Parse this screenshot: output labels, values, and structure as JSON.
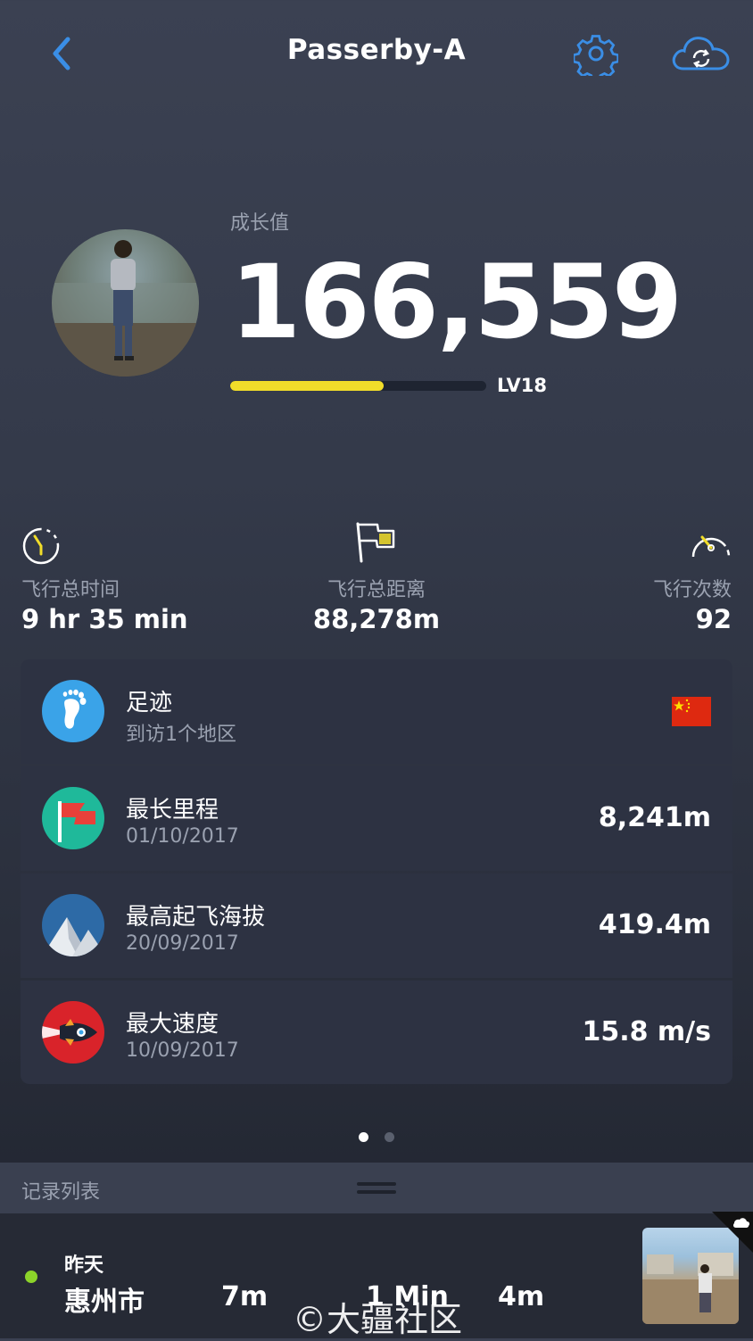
{
  "header": {
    "title": "Passerby-A",
    "back_icon": "chevron-left-icon",
    "settings_icon": "gear-icon",
    "sync_icon": "cloud-sync-icon",
    "accent": "#3a8ee6"
  },
  "profile": {
    "growth_label": "成长值",
    "growth_value": "166,559",
    "level": "LV18",
    "level_progress": 0.6,
    "bar_color": "#f1dd2a"
  },
  "stats": [
    {
      "label": "飞行总时间",
      "value": "9 hr 35 min",
      "icon": "stopwatch-icon"
    },
    {
      "label": "飞行总距离",
      "value": "88,278m",
      "icon": "flag-icon"
    },
    {
      "label": "飞行次数",
      "value": "92",
      "icon": "speedometer-icon"
    }
  ],
  "records": [
    {
      "title": "足迹",
      "subtitle": "到访1个地区",
      "value": "",
      "icon": "footprint-icon",
      "badge": "china-flag-icon"
    },
    {
      "title": "最长里程",
      "subtitle": "01/10/2017",
      "value": "8,241m",
      "icon": "red-flag-icon"
    },
    {
      "title": "最高起飞海拔",
      "subtitle": "20/09/2017",
      "value": "419.4m",
      "icon": "mountain-icon"
    },
    {
      "title": "最大速度",
      "subtitle": "10/09/2017",
      "value": "15.8 m/s",
      "icon": "rocket-icon"
    }
  ],
  "pager": {
    "pages": 2,
    "active": 1
  },
  "record_list": {
    "title": "记录列表",
    "item": {
      "day": "昨天",
      "city": "惠州市",
      "distance": "7m",
      "duration": "1 Min",
      "height": "4m"
    }
  },
  "watermark": "©大疆社区"
}
